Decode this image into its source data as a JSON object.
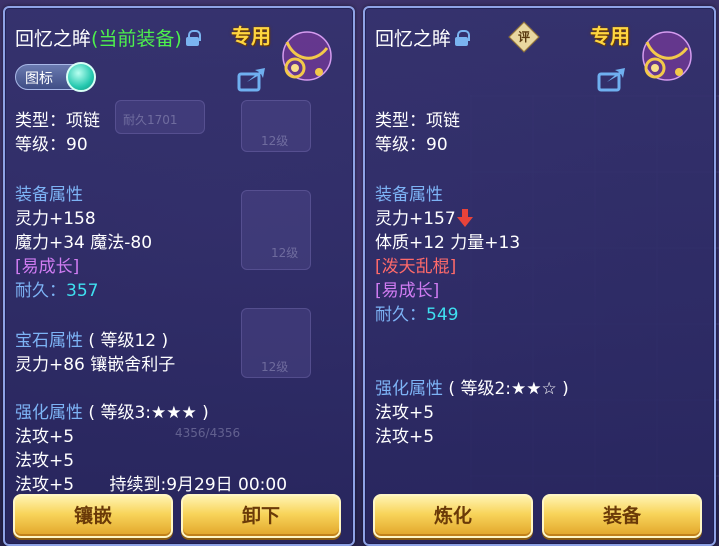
{
  "colors": {
    "panel_border": "#8fa3e6",
    "section_blue": "#7db3f5",
    "durability_cyan": "#3fe0f0",
    "growth_purple": "#d07cf2",
    "red_attr": "#ff6a6a",
    "current_green": "#4df04d",
    "exclusive_gold": "#ffd640",
    "button_gold": "#f8d45a"
  },
  "left": {
    "title": "回忆之眸",
    "title_suffix": "(当前装备)",
    "exclusive": "专用",
    "toggle_label": "图标",
    "type_line": "类型：项链",
    "level_line": "等级：90",
    "equip_attr_header": "装备属性",
    "attrs": [
      "灵力+158",
      "魔力+34 魔法-80"
    ],
    "growth": "[易成长]",
    "durability_label": "耐久：",
    "durability_value": "357",
    "gem_header": "宝石属性",
    "gem_level": "( 等级12 )",
    "gem_line": "灵力+86 镶嵌舍利子",
    "enhance_header": "强化属性",
    "enhance_level": "( 等级3:★★★ )",
    "enhance_lines": [
      "法攻+5",
      "法攻+5"
    ],
    "enhance_last": "法攻+5",
    "duration": "持续到:9月29日 00:00",
    "buttons": {
      "inlay": "镶嵌",
      "unequip": "卸下"
    },
    "bg_texts": {
      "dur": "耐久1701",
      "lv1": "12级",
      "lv2": "12级",
      "lv3": "12级",
      "hp": "4356/4356"
    }
  },
  "right": {
    "title": "回忆之眸",
    "eval_badge": "评",
    "exclusive": "专用",
    "type_line": "类型：项链",
    "level_line": "等级：90",
    "equip_attr_header": "装备属性",
    "attr1": "灵力+157",
    "attr2": "体质+12 力量+13",
    "special": "[泼天乱棍]",
    "growth": "[易成长]",
    "durability_label": "耐久：",
    "durability_value": "549",
    "enhance_header": "强化属性",
    "enhance_level": "( 等级2:★★☆ )",
    "enhance_lines": [
      "法攻+5",
      "法攻+5"
    ],
    "buttons": {
      "refine": "炼化",
      "equip": "装备"
    }
  },
  "icons": [
    "lock-icon",
    "share-icon",
    "necklace-icon",
    "down-arrow-icon",
    "toggle-knob-icon",
    "eval-badge-icon"
  ]
}
